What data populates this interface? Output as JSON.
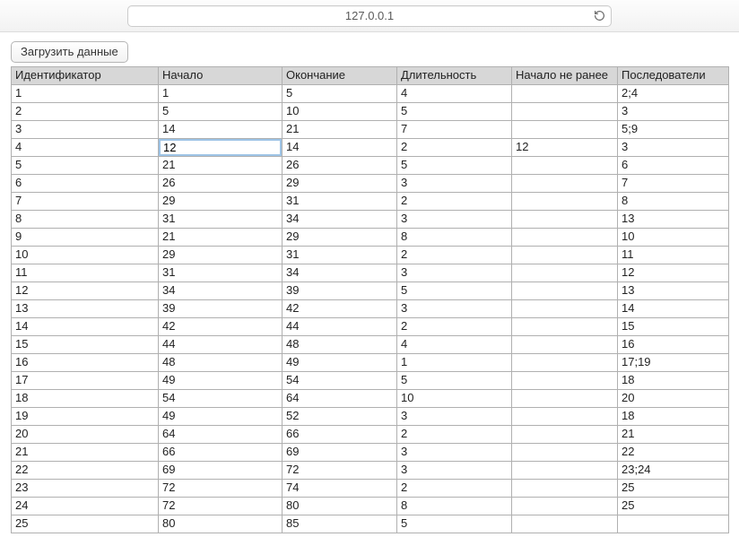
{
  "address_bar": {
    "url": "127.0.0.1"
  },
  "toolbar": {
    "load_button_label": "Загрузить данные"
  },
  "table": {
    "headers": [
      "Идентификатор",
      "Начало",
      "Окончание",
      "Длительность",
      "Начало не ранее",
      "Последователи"
    ],
    "rows": [
      {
        "id": "1",
        "start": "1",
        "end": "5",
        "duration": "4",
        "not_before": "",
        "successors": "2;4"
      },
      {
        "id": "2",
        "start": "5",
        "end": "10",
        "duration": "5",
        "not_before": "",
        "successors": "3"
      },
      {
        "id": "3",
        "start": "14",
        "end": "21",
        "duration": "7",
        "not_before": "",
        "successors": "5;9"
      },
      {
        "id": "4",
        "start": "12",
        "end": "14",
        "duration": "2",
        "not_before": "12",
        "successors": "3"
      },
      {
        "id": "5",
        "start": "21",
        "end": "26",
        "duration": "5",
        "not_before": "",
        "successors": "6"
      },
      {
        "id": "6",
        "start": "26",
        "end": "29",
        "duration": "3",
        "not_before": "",
        "successors": "7"
      },
      {
        "id": "7",
        "start": "29",
        "end": "31",
        "duration": "2",
        "not_before": "",
        "successors": "8"
      },
      {
        "id": "8",
        "start": "31",
        "end": "34",
        "duration": "3",
        "not_before": "",
        "successors": "13"
      },
      {
        "id": "9",
        "start": "21",
        "end": "29",
        "duration": "8",
        "not_before": "",
        "successors": "10"
      },
      {
        "id": "10",
        "start": "29",
        "end": "31",
        "duration": "2",
        "not_before": "",
        "successors": "11"
      },
      {
        "id": "11",
        "start": "31",
        "end": "34",
        "duration": "3",
        "not_before": "",
        "successors": "12"
      },
      {
        "id": "12",
        "start": "34",
        "end": "39",
        "duration": "5",
        "not_before": "",
        "successors": "13"
      },
      {
        "id": "13",
        "start": "39",
        "end": "42",
        "duration": "3",
        "not_before": "",
        "successors": "14"
      },
      {
        "id": "14",
        "start": "42",
        "end": "44",
        "duration": "2",
        "not_before": "",
        "successors": "15"
      },
      {
        "id": "15",
        "start": "44",
        "end": "48",
        "duration": "4",
        "not_before": "",
        "successors": "16"
      },
      {
        "id": "16",
        "start": "48",
        "end": "49",
        "duration": "1",
        "not_before": "",
        "successors": "17;19"
      },
      {
        "id": "17",
        "start": "49",
        "end": "54",
        "duration": "5",
        "not_before": "",
        "successors": "18"
      },
      {
        "id": "18",
        "start": "54",
        "end": "64",
        "duration": "10",
        "not_before": "",
        "successors": "20"
      },
      {
        "id": "19",
        "start": "49",
        "end": "52",
        "duration": "3",
        "not_before": "",
        "successors": "18"
      },
      {
        "id": "20",
        "start": "64",
        "end": "66",
        "duration": "2",
        "not_before": "",
        "successors": "21"
      },
      {
        "id": "21",
        "start": "66",
        "end": "69",
        "duration": "3",
        "not_before": "",
        "successors": "22"
      },
      {
        "id": "22",
        "start": "69",
        "end": "72",
        "duration": "3",
        "not_before": "",
        "successors": "23;24"
      },
      {
        "id": "23",
        "start": "72",
        "end": "74",
        "duration": "2",
        "not_before": "",
        "successors": "25"
      },
      {
        "id": "24",
        "start": "72",
        "end": "80",
        "duration": "8",
        "not_before": "",
        "successors": "25"
      },
      {
        "id": "25",
        "start": "80",
        "end": "85",
        "duration": "5",
        "not_before": "",
        "successors": ""
      }
    ],
    "editing": {
      "row_index": 3,
      "field": "start"
    }
  }
}
